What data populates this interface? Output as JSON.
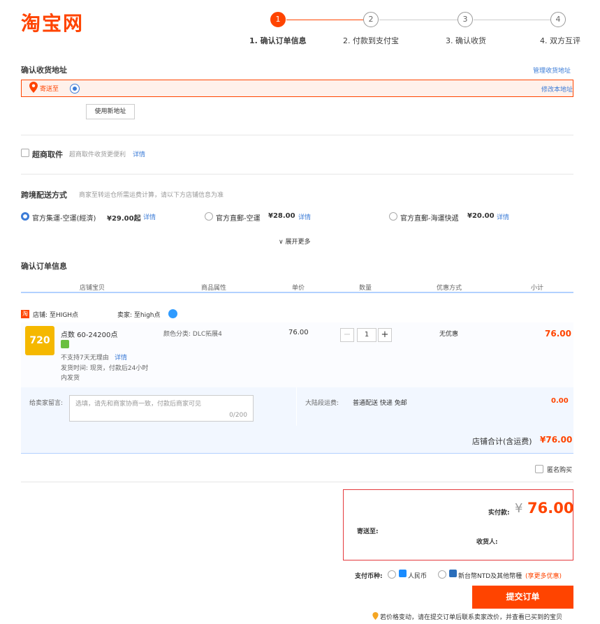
{
  "header": {
    "logo": "淘宝网",
    "steps": [
      {
        "num": "1",
        "label": "1. 确认订单信息"
      },
      {
        "num": "2",
        "label": "2. 付款到支付宝"
      },
      {
        "num": "3",
        "label": "3. 确认收货"
      },
      {
        "num": "4",
        "label": "4. 双方互评"
      }
    ]
  },
  "address": {
    "title": "确认收货地址",
    "manage_link": "管理收货地址",
    "ship_to": "寄送至",
    "edit_link": "修改本地址",
    "new_address_btn": "使用新地址"
  },
  "pickup": {
    "label": "超商取件",
    "desc": "超商取件收货更便利",
    "detail": "详情"
  },
  "shipping": {
    "title": "跨境配送方式",
    "desc": "商家至转运仓所需运费计算，请以下方店铺信息为准",
    "options": [
      {
        "label": "官方集運-空運(經濟)",
        "price": "¥29.00起",
        "detail": "详情",
        "selected": true
      },
      {
        "label": "官方直郵-空運",
        "price": "¥28.00",
        "detail": "详情",
        "selected": false
      },
      {
        "label": "官方直郵-海運快遞",
        "price": "¥20.00",
        "detail": "详情",
        "selected": false
      }
    ],
    "expand": "展开更多"
  },
  "order": {
    "title": "确认订单信息",
    "columns": [
      "店铺宝贝",
      "商品属性",
      "单价",
      "数量",
      "优惠方式",
      "小计"
    ],
    "shop_label": "店铺: 至HIGH点",
    "seller_label": "卖家: 至high点",
    "item": {
      "name": "点数 60-24200点",
      "thumb_text": "720",
      "no_return": "不支持7天无理由",
      "detail": "详情",
      "ship_time": "发货时间: 现货，付款后24小时",
      "ship_time2": "内发货",
      "attr": "颜色分类: DLC拓展4",
      "unit_price": "76.00",
      "qty": "1",
      "discount": "无优惠",
      "subtotal": "76.00"
    },
    "message_label": "给卖家留言:",
    "message_placeholder": "选填，请先和商家协商一致，付款后商家可见",
    "message_count": "0/200",
    "domestic_label": "大陆段运费:",
    "domestic_value": "普通配送 快递 免邮",
    "domestic_price": "0.00",
    "shop_total_label": "店铺合计(含运费)",
    "shop_total": "¥76.00",
    "anonymous": "匿名购买"
  },
  "payment": {
    "actual_label": "实付款:",
    "currency_symbol": "¥",
    "actual_value": "76.00",
    "ship_to_label": "寄送至:",
    "receiver_label": "收货人:",
    "currency_title": "支付币种:",
    "rmb": "人民币",
    "ntd": "新台幣NTD及其他幣種",
    "more_discount": "(享更多优惠)",
    "submit": "提交订单",
    "notice": "若价格变动，请在提交订单后联系卖家改价，并查看已买到的宝贝"
  },
  "colors": {
    "accent": "#ff4400",
    "link": "#3c7cd7"
  }
}
